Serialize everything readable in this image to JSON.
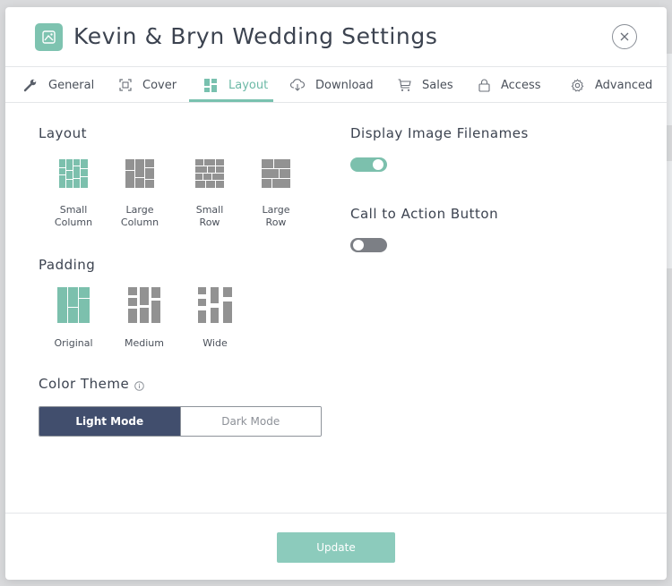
{
  "modal": {
    "title": "Kevin & Bryn Wedding Settings"
  },
  "tabs": [
    {
      "label": "General",
      "icon": "wrench-icon"
    },
    {
      "label": "Cover",
      "icon": "cover-icon"
    },
    {
      "label": "Layout",
      "icon": "layout-icon",
      "active": true
    },
    {
      "label": "Download",
      "icon": "cloud-download-icon"
    },
    {
      "label": "Sales",
      "icon": "cart-icon"
    },
    {
      "label": "Access",
      "icon": "lock-icon"
    },
    {
      "label": "Advanced",
      "icon": "gear-icon"
    }
  ],
  "layout": {
    "label": "Layout",
    "options": [
      {
        "line1": "Small",
        "line2": "Column",
        "selected": true
      },
      {
        "line1": "Large",
        "line2": "Column"
      },
      {
        "line1": "Small",
        "line2": "Row"
      },
      {
        "line1": "Large",
        "line2": "Row"
      }
    ]
  },
  "padding": {
    "label": "Padding",
    "options": [
      {
        "label": "Original",
        "selected": true
      },
      {
        "label": "Medium"
      },
      {
        "label": "Wide"
      }
    ]
  },
  "color_theme": {
    "label": "Color Theme",
    "light": "Light Mode",
    "dark": "Dark Mode",
    "selected": "Light Mode"
  },
  "display_filenames": {
    "label": "Display Image Filenames",
    "enabled": true
  },
  "cta": {
    "label": "Call to Action Button",
    "enabled": false
  },
  "footer": {
    "update_label": "Update"
  },
  "colors": {
    "accent": "#7ec3b0",
    "dark_selected": "#414e6d",
    "inactive_glyph": "#929292"
  }
}
